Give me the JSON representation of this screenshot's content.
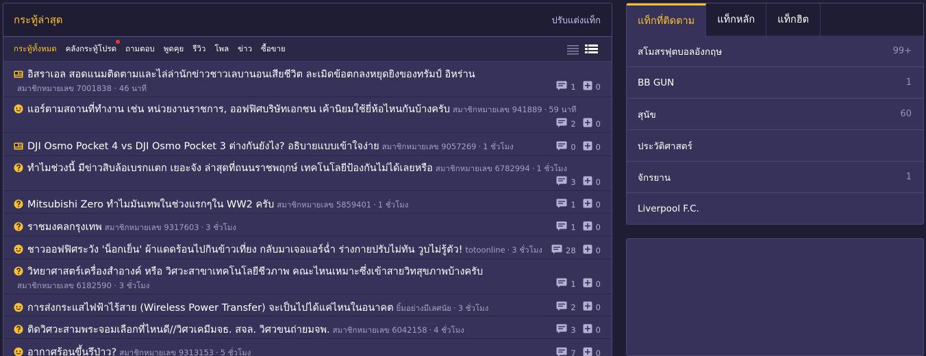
{
  "header": {
    "title": "กระทู้ล่าสุด",
    "customize": "ปรับแต่งแท็ก"
  },
  "tabs": [
    "กระทู้ทั้งหมด",
    "คลังกระทู้โปรด",
    "ถามตอบ",
    "พูดคุย",
    "รีวิว",
    "โพล",
    "ข่าว",
    "ซื้อขาย"
  ],
  "topics": [
    {
      "icon": "news-icon",
      "title": "อิสราเอล สอดแนมติดตามและไล่ล่านักข่าวชาวเลบานอนเสียชีวิต ละเมิดข้อตกลงหยุดยิงของทรัมป์ อิหร่าน",
      "author": "สมาชิกหมายเลข 7001838",
      "time": "46 นาที",
      "comments": "1",
      "votes": "0"
    },
    {
      "icon": "chat-icon",
      "title": "แอร์ตามสถานที่ทำงาน เช่น หน่วยงานราชการ, ออฟฟิศบริษัทเอกชน เค้านิยมใช้ยี่ห้อไหนกันบ้างครับ",
      "author": "สมาชิกหมายเลข 941889",
      "time": "59 นาที",
      "comments": "2",
      "votes": "0"
    },
    {
      "icon": "news-icon",
      "title": "DJI Osmo Pocket 4 vs DJI Osmo Pocket 3 ต่างกันยังไง? อธิบายแบบเข้าใจง่าย",
      "author": "สมาชิกหมายเลข 9057269",
      "time": "1 ชั่วโมง",
      "comments": "0",
      "votes": "0"
    },
    {
      "icon": "question-icon",
      "title": "ทำไมช่วงนี้ มีข่าวสิบล้อเบรกแตก เยอะจัง ล่าสุดที่ถนนราชพฤกษ์ เทคโนโลยีป้องกันไม่ได้เลยหรือ",
      "author": "สมาชิกหมายเลข 6782994",
      "time": "1 ชั่วโมง",
      "comments": "3",
      "votes": "0"
    },
    {
      "icon": "question-icon",
      "title": "Mitsubishi Zero ทำไมมันเทพในช่วงแรกๆใน WW2 ครับ",
      "author": "สมาชิกหมายเลข 5859401",
      "time": "1 ชั่วโมง",
      "comments": "1",
      "votes": "0"
    },
    {
      "icon": "question-icon",
      "title": "ราชมงคลกรุงเทพ",
      "author": "สมาชิกหมายเลข 9317603",
      "time": "3 ชั่วโมง",
      "comments": "1",
      "votes": "0"
    },
    {
      "icon": "chat-icon",
      "title": "ชาวออฟฟิศระวัง 'น็อกเย็น' ผ้าแดดร้อนไปกินข้าวเที่ยง กลับมาเจอแอร์ฉ่ำ ร่างกายปรับไม่ทัน วูบไม่รู้ตัว!",
      "author": "totoonline",
      "time": "3 ชั่วโมง",
      "comments": "28",
      "votes": "0"
    },
    {
      "icon": "question-icon",
      "title": "วิทยาศาสตร์เครื่องสำอางค์ หรือ วิศวะสาขาเทคโนโลยีชีวภาพ คณะไหนเหมาะซึ่งเข้าสายวิทสุขภาพบ้างครับ",
      "author": "สมาชิกหมายเลข 6182590",
      "time": "3 ชั่วโมง",
      "comments": "1",
      "votes": "0"
    },
    {
      "icon": "chat-icon",
      "title": "การส่งกระแสไฟฟ้าไร้สาย (Wireless Power Transfer) จะเป็นไปได้แค่ไหนในอนาคต",
      "author": "ยิ้มอย่างมีเลศนัย",
      "time": "3 ชั่วโมง",
      "comments": "2",
      "votes": "0"
    },
    {
      "icon": "question-icon",
      "title": "ติดวิศวะสามพระจอมเลือกที่ไหนดี//วิศวเคมีมจธ. สจล. วิศวขนถ่ายมจพ.",
      "author": "สมาชิกหมายเลข 6042158",
      "time": "4 ชั่วโมง",
      "comments": "3",
      "votes": "0"
    },
    {
      "icon": "chat-icon",
      "title": "อากาศร้อนขึ้นรึป่าว?",
      "author": "สมาชิกหมายเลข 9313153",
      "time": "5 ชั่วโมง",
      "comments": "7",
      "votes": "0"
    }
  ],
  "right_tabs": [
    "แท็กที่ติดตาม",
    "แท็กหลัก",
    "แท็กฮิต"
  ],
  "tags": [
    {
      "name": "สโมสรฟุตบอลอังกฤษ",
      "count": "99+"
    },
    {
      "name": "BB GUN",
      "count": "1"
    },
    {
      "name": "สุนัข",
      "count": "60"
    },
    {
      "name": "ประวัติศาสตร์",
      "count": ""
    },
    {
      "name": "จักรยาน",
      "count": "1"
    },
    {
      "name": "Liverpool F.C.",
      "count": ""
    }
  ],
  "colors": {
    "accent": "#fbc02d",
    "panel": "#37325a",
    "background": "#1f1d33"
  }
}
